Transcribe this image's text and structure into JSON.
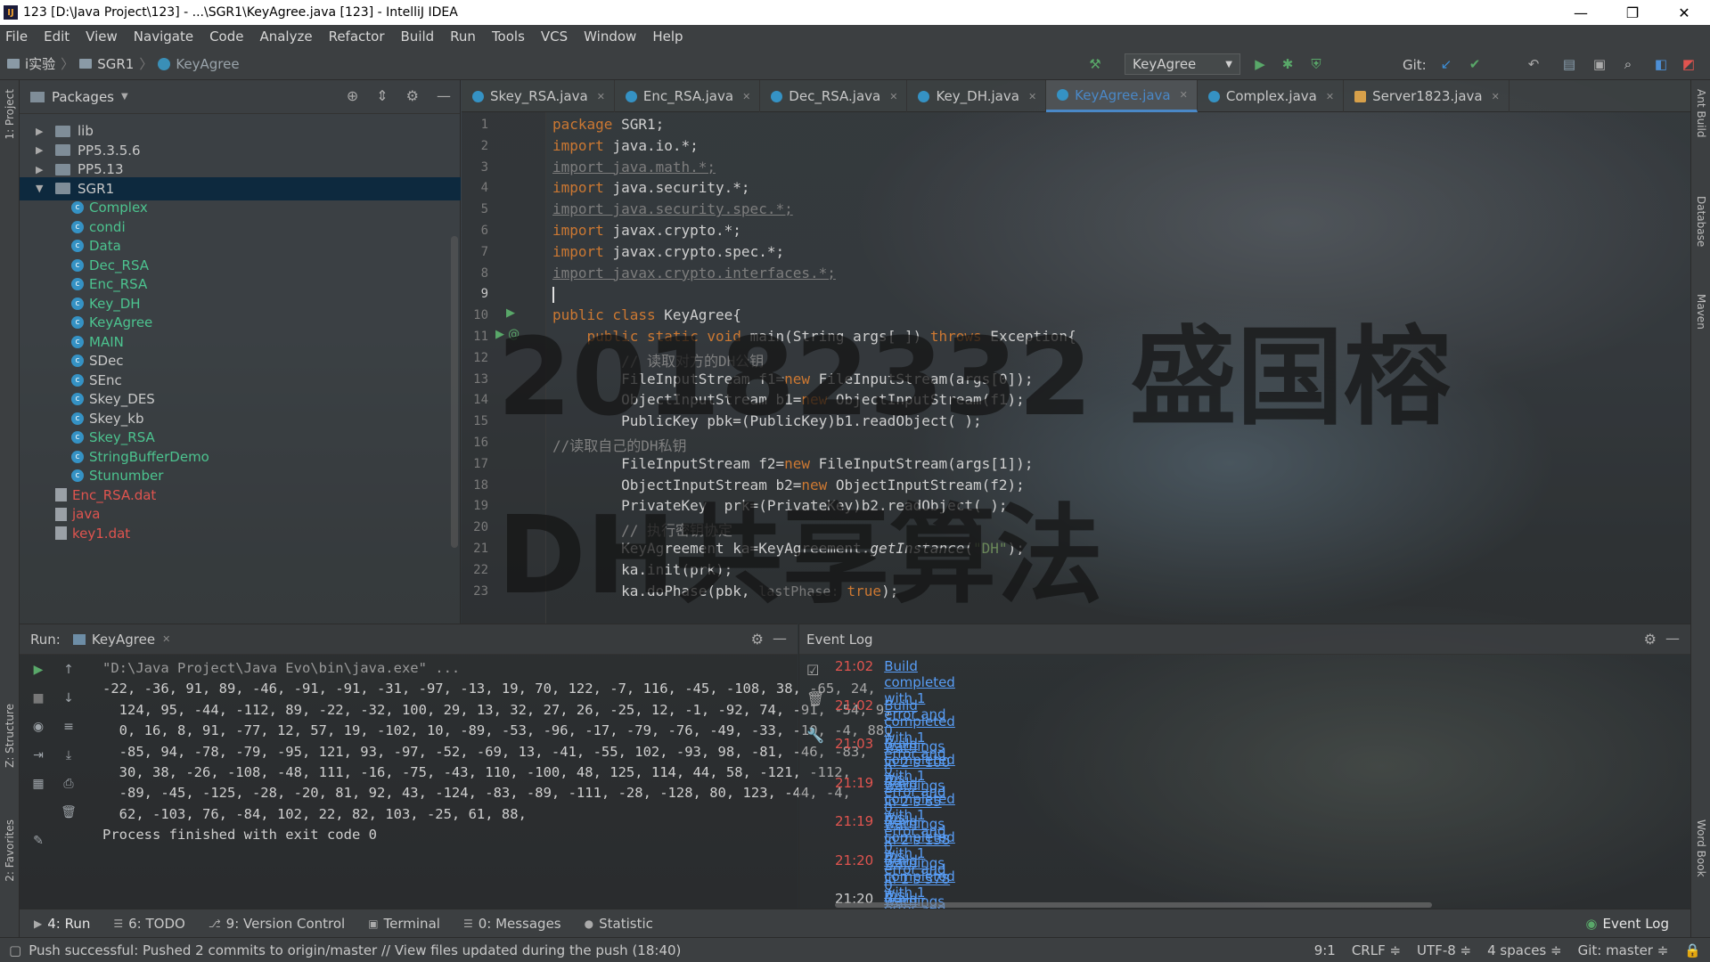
{
  "window": {
    "title": "123 [D:\\Java Project\\123] - ...\\SGR1\\KeyAgree.java [123] - IntelliJ IDEA",
    "app_icon": "IJ",
    "controls": [
      "—",
      "❐",
      "✕"
    ]
  },
  "menu": [
    "File",
    "Edit",
    "View",
    "Navigate",
    "Code",
    "Analyze",
    "Refactor",
    "Build",
    "Run",
    "Tools",
    "VCS",
    "Window",
    "Help"
  ],
  "navbar": {
    "crumbs": [
      "i实验",
      "SGR1",
      "KeyAgree"
    ],
    "run_config": "KeyAgree",
    "git_label": "Git:"
  },
  "project": {
    "view": "Packages",
    "tree": [
      {
        "label": "lib",
        "kind": "folder",
        "expanded": false
      },
      {
        "label": "PP5.3.5.6",
        "kind": "folder",
        "expanded": false
      },
      {
        "label": "PP5.13",
        "kind": "folder",
        "expanded": false
      },
      {
        "label": "SGR1",
        "kind": "folder",
        "expanded": true,
        "selected": true
      },
      {
        "label": "Complex",
        "kind": "class",
        "color": "green"
      },
      {
        "label": "condi",
        "kind": "class",
        "color": "green"
      },
      {
        "label": "Data",
        "kind": "class",
        "color": "green"
      },
      {
        "label": "Dec_RSA",
        "kind": "class",
        "color": "green"
      },
      {
        "label": "Enc_RSA",
        "kind": "class",
        "color": "green"
      },
      {
        "label": "Key_DH",
        "kind": "class",
        "color": "green"
      },
      {
        "label": "KeyAgree",
        "kind": "class",
        "color": "green"
      },
      {
        "label": "MAIN",
        "kind": "class",
        "color": "green"
      },
      {
        "label": "SDec",
        "kind": "class",
        "color": "normal"
      },
      {
        "label": "SEnc",
        "kind": "class",
        "color": "normal"
      },
      {
        "label": "Skey_DES",
        "kind": "class",
        "color": "normal"
      },
      {
        "label": "Skey_kb",
        "kind": "class",
        "color": "normal"
      },
      {
        "label": "Skey_RSA",
        "kind": "class",
        "color": "green"
      },
      {
        "label": "StringBufferDemo",
        "kind": "class",
        "color": "green"
      },
      {
        "label": "Stunumber",
        "kind": "class",
        "color": "green"
      },
      {
        "label": "Enc_RSA.dat",
        "kind": "file",
        "color": "red"
      },
      {
        "label": "java",
        "kind": "file",
        "color": "red"
      },
      {
        "label": "key1.dat",
        "kind": "file",
        "color": "red"
      }
    ]
  },
  "tabs": [
    {
      "label": "Skey_RSA.java",
      "active": false
    },
    {
      "label": "Enc_RSA.java",
      "active": false
    },
    {
      "label": "Dec_RSA.java",
      "active": false
    },
    {
      "label": "Key_DH.java",
      "active": false
    },
    {
      "label": "KeyAgree.java",
      "active": true
    },
    {
      "label": "Complex.java",
      "active": false
    },
    {
      "label": "Server1823.java",
      "active": false
    }
  ],
  "editor": {
    "line_numbers": [
      "1",
      "2",
      "3",
      "4",
      "5",
      "6",
      "7",
      "8",
      "9",
      "10",
      "11",
      "12",
      "13",
      "14",
      "15",
      "16",
      "17",
      "18",
      "19",
      "20",
      "21",
      "22",
      "23"
    ],
    "lines": [
      [
        [
          "kw",
          "package "
        ],
        [
          "",
          "SGR1;"
        ]
      ],
      [
        [
          "kw",
          "import "
        ],
        [
          "",
          "java.io.*;"
        ]
      ],
      [
        [
          "imp",
          "import java.math.*;"
        ]
      ],
      [
        [
          "kw",
          "import "
        ],
        [
          "",
          "java.security.*;"
        ]
      ],
      [
        [
          "imp",
          "import java.security.spec.*;"
        ]
      ],
      [
        [
          "kw",
          "import "
        ],
        [
          "",
          "javax.crypto.*;"
        ]
      ],
      [
        [
          "kw",
          "import "
        ],
        [
          "",
          "javax.crypto.spec.*;"
        ]
      ],
      [
        [
          "imp",
          "import javax.crypto.interfaces.*;"
        ]
      ],
      [
        [
          "",
          ""
        ]
      ],
      [
        [
          "kw",
          "public class "
        ],
        [
          "",
          "KeyAgree{"
        ]
      ],
      [
        [
          "kw",
          "    public static void "
        ],
        [
          "",
          "main(String args[ ]) "
        ],
        [
          "kw",
          "throws "
        ],
        [
          "",
          "Exception{"
        ]
      ],
      [
        [
          "cm",
          "        // 读取对方的DH公钥"
        ]
      ],
      [
        [
          "",
          "        FileInputStream f1="
        ],
        [
          "kw",
          "new "
        ],
        [
          "",
          "FileInputStream(args[0]);"
        ]
      ],
      [
        [
          "",
          "        ObjectInputStream b1="
        ],
        [
          "kw",
          "new "
        ],
        [
          "",
          "ObjectInputStream(f1);"
        ]
      ],
      [
        [
          "",
          "        PublicKey pbk=(PublicKey)b1.readObject( );"
        ]
      ],
      [
        [
          "cm",
          "//读取自己的DH私钥"
        ]
      ],
      [
        [
          "",
          "        FileInputStream f2="
        ],
        [
          "kw",
          "new "
        ],
        [
          "",
          "FileInputStream(args[1]);"
        ]
      ],
      [
        [
          "",
          "        ObjectInputStream b2="
        ],
        [
          "kw",
          "new "
        ],
        [
          "",
          "ObjectInputStream(f2);"
        ]
      ],
      [
        [
          "",
          "        PrivateKey  prk=(PrivateKey)b2.readObject( );"
        ]
      ],
      [
        [
          "cm",
          "        // 执行密钥协定"
        ]
      ],
      [
        [
          "",
          "        KeyAgreement ka=KeyAgreement."
        ],
        [
          "it",
          "getInstance"
        ],
        [
          "",
          "("
        ],
        [
          "str",
          "\"DH\""
        ],
        [
          "",
          ");"
        ]
      ],
      [
        [
          "",
          "        ka.init(prk);"
        ]
      ],
      [
        [
          "",
          "        ka.doPhase(pbk, "
        ],
        [
          "hint",
          "lastPhase: "
        ],
        [
          "kw",
          "true"
        ],
        [
          "",
          ");"
        ]
      ]
    ],
    "watermark_top": "20182332 盛国榕",
    "watermark_bottom": "DH共享算法"
  },
  "run": {
    "label": "Run:",
    "tab": "KeyAgree",
    "output": [
      "\"D:\\Java Project\\Java Evo\\bin\\java.exe\" ...",
      "-22, -36, 91, 89, -46, -91, -91, -31, -97, -13, 19, 70, 122, -7, 116, -45, -108, 38, -65, 24,",
      "  124, 95, -44, -112, 89, -22, -32, 100, 29, 13, 32, 27, 26, -25, 12, -1, -92, 74, -91, -54, 9,",
      "  0, 16, 8, 91, -77, 12, 57, 19, -102, 10, -89, -53, -96, -17, -79, -76, -49, -33, -10, -4, 88,",
      "  -85, 94, -78, -79, -95, 121, 93, -97, -52, -69, 13, -41, -55, 102, -93, 98, -81, -46, -83,",
      "  30, 38, -26, -108, -48, 111, -16, -75, -43, 110, -100, 48, 125, 114, 44, 58, -121, -112,",
      "  -89, -45, -125, -28, -20, 81, 92, 43, -124, -83, -89, -111, -28, -128, 80, 123, -44, -4,",
      "  62, -103, 76, -84, 102, 22, 82, 103, -25, 61, 88,",
      "Process finished with exit code 0"
    ]
  },
  "event_log": {
    "title": "Event Log",
    "entries": [
      {
        "time": "21:02",
        "msg": "Build completed with 1 error and 0 warnings in 2 s 100 ms",
        "error": true
      },
      {
        "time": "21:02",
        "msg": "Build completed with 1 error and 0 warnings in 2 s 85 ms",
        "error": true
      },
      {
        "time": "21:03",
        "msg": "Build completed with 1 error and 0 warnings in 2 s 138 ms",
        "error": true
      },
      {
        "time": "21:19",
        "msg": "Build completed with 1 error and 0 warnings in 1 s 578 ms",
        "error": true
      },
      {
        "time": "21:19",
        "msg": "Build completed with 1 error and 0 warnings in 1 s 524 ms",
        "error": true
      },
      {
        "time": "21:20",
        "msg": "Build completed with 1 error and 0 warnings in 1 s 516 ms",
        "error": true
      },
      {
        "time": "21:20",
        "msg": "Build completed successfully in 1 s 635 ms",
        "error": false
      }
    ]
  },
  "left_strip": [
    "1: Project",
    "Z: Structure",
    "2: Favorites"
  ],
  "right_strip": [
    "Ant Build",
    "Database",
    "Maven",
    "Word Book"
  ],
  "tool_tabs": [
    {
      "label": "4: Run",
      "icon": "▶",
      "active": true
    },
    {
      "label": "6: TODO",
      "icon": "☰",
      "active": false
    },
    {
      "label": "9: Version Control",
      "icon": "⎇",
      "active": false
    },
    {
      "label": "Terminal",
      "icon": "▣",
      "active": false
    },
    {
      "label": "0: Messages",
      "icon": "☰",
      "active": false
    },
    {
      "label": "Statistic",
      "icon": "●",
      "active": false
    }
  ],
  "event_log_button": "Event Log",
  "status": {
    "message": "Push successful: Pushed 2 commits to origin/master // View files updated during the push (18:40)",
    "position": "9:1",
    "line_sep": "CRLF ≑",
    "encoding": "UTF-8 ≑",
    "indent": "4 spaces ≑",
    "git": "Git: master ≑"
  }
}
